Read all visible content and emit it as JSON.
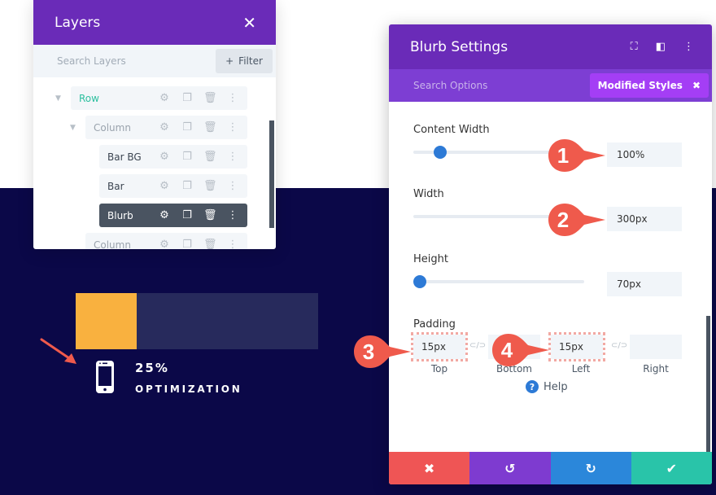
{
  "layers": {
    "title": "Layers",
    "search_placeholder": "Search Layers",
    "filter_label": "Filter",
    "items": [
      {
        "label": "Row",
        "level": "row",
        "expanded": true
      },
      {
        "label": "Column",
        "level": "column",
        "expanded": true
      },
      {
        "label": "Bar BG",
        "level": "module"
      },
      {
        "label": "Bar",
        "level": "module"
      },
      {
        "label": "Blurb",
        "level": "module",
        "active": true
      },
      {
        "label": "Column",
        "level": "column"
      }
    ]
  },
  "preview": {
    "bar_progress_percent": 25,
    "bar_fill_color": "#f9b13f",
    "bar_bg_color": "#272a5c",
    "blurb_title": "25%",
    "blurb_subtitle": "OPTIMIZATION",
    "blurb_icon": "mobile-phone-icon"
  },
  "settings": {
    "title": "Blurb Settings",
    "search_placeholder": "Search Options",
    "modified_styles_label": "Modified Styles",
    "fields": {
      "content_width": {
        "label": "Content Width",
        "value": "100%",
        "slider_fraction": 0.12
      },
      "width": {
        "label": "Width",
        "value": "300px"
      },
      "height": {
        "label": "Height",
        "value": "70px",
        "slider_fraction": 0.0
      },
      "padding": {
        "label": "Padding",
        "top": {
          "label": "Top",
          "value": "15px"
        },
        "bottom": {
          "label": "Bottom",
          "value": ""
        },
        "left": {
          "label": "Left",
          "value": "15px"
        },
        "right": {
          "label": "Right",
          "value": ""
        }
      }
    },
    "help_label": "Help",
    "footer": {
      "cancel": "✖",
      "undo": "↺",
      "redo": "↻",
      "save": "✔"
    }
  },
  "callouts": [
    "1",
    "2",
    "3",
    "4"
  ],
  "colors": {
    "header_purple": "#6a2bb8",
    "search_purple": "#7d3ed3",
    "accent_blue": "#2d7ad6",
    "cancel_red": "#ef5555",
    "save_teal": "#29c4a9",
    "callout_red": "#ef5a4c"
  }
}
